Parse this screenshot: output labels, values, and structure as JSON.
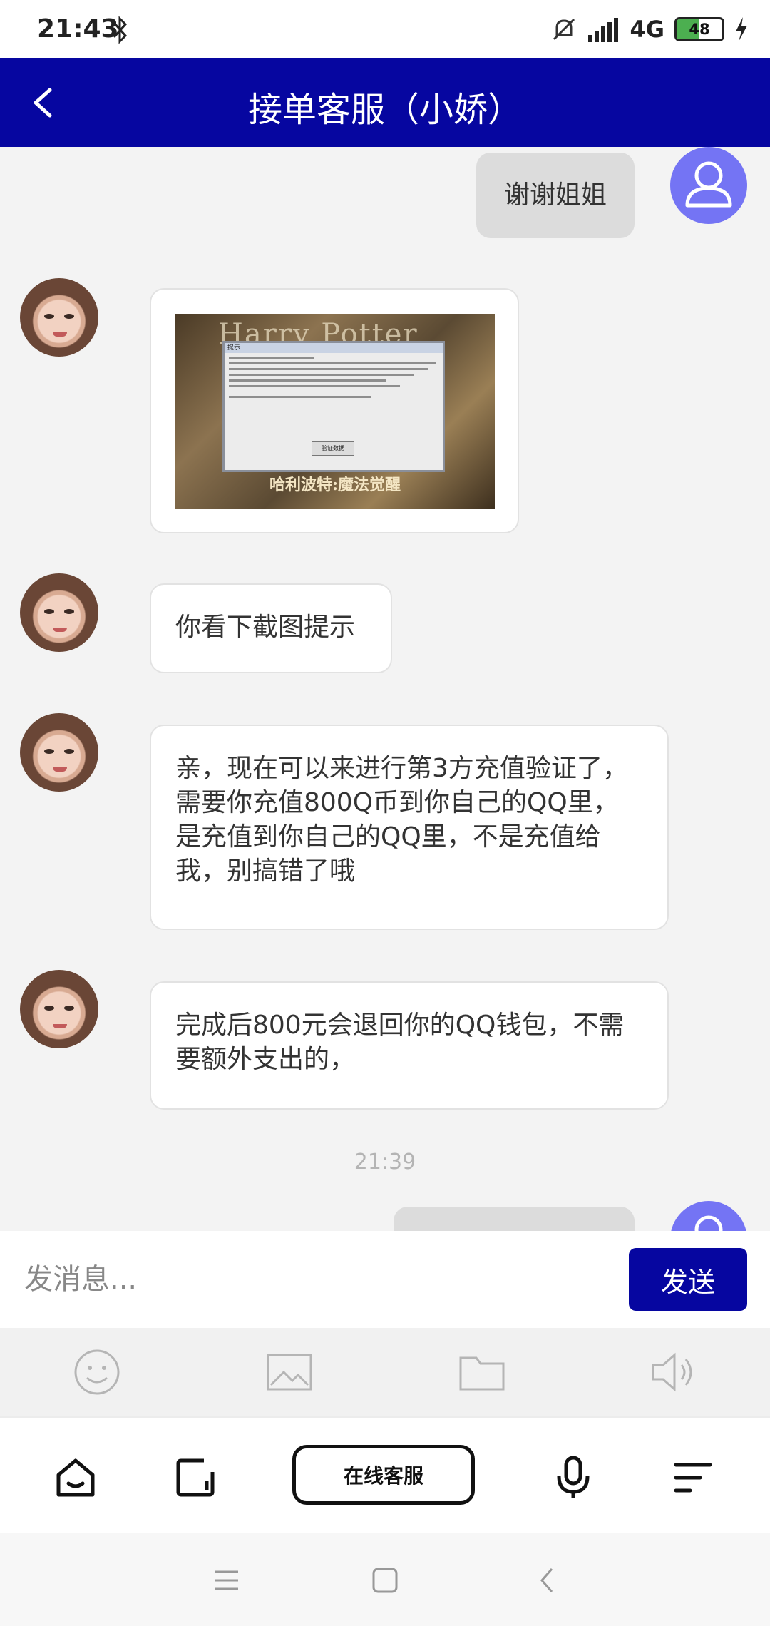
{
  "status_bar": {
    "time": "21:43",
    "network": "4G",
    "battery": "48",
    "battery_level": 0.48
  },
  "header": {
    "title": "接单客服（小娇）"
  },
  "messages": {
    "self_1": "谢谢姐姐",
    "agent_1": "你看下截图提示",
    "agent_2": "亲，现在可以来进行第3方充值验证了，需要你充值800Q币到你自己的QQ里，是充值到你自己的QQ里，不是充值给我，别搞错了哦",
    "agent_3": "完成后800元会退回你的QQ钱包，不需要额外支出的，",
    "timestamp": "21:39"
  },
  "screenshot_image": {
    "top_text": "Harry Potter",
    "dialog_title": "提示",
    "button": "验证数据",
    "caption": "哈利波特:魔法觉醒"
  },
  "input": {
    "placeholder": "发消息...",
    "send_label": "发送"
  },
  "tools": [
    "emoji-icon",
    "image-icon",
    "folder-icon",
    "speaker-icon"
  ],
  "app_nav": {
    "online_service_label": "在线客服"
  },
  "colors": {
    "brand": "#0606a0",
    "self_avatar": "#7474f4",
    "self_bubble": "#dcdcdc"
  }
}
